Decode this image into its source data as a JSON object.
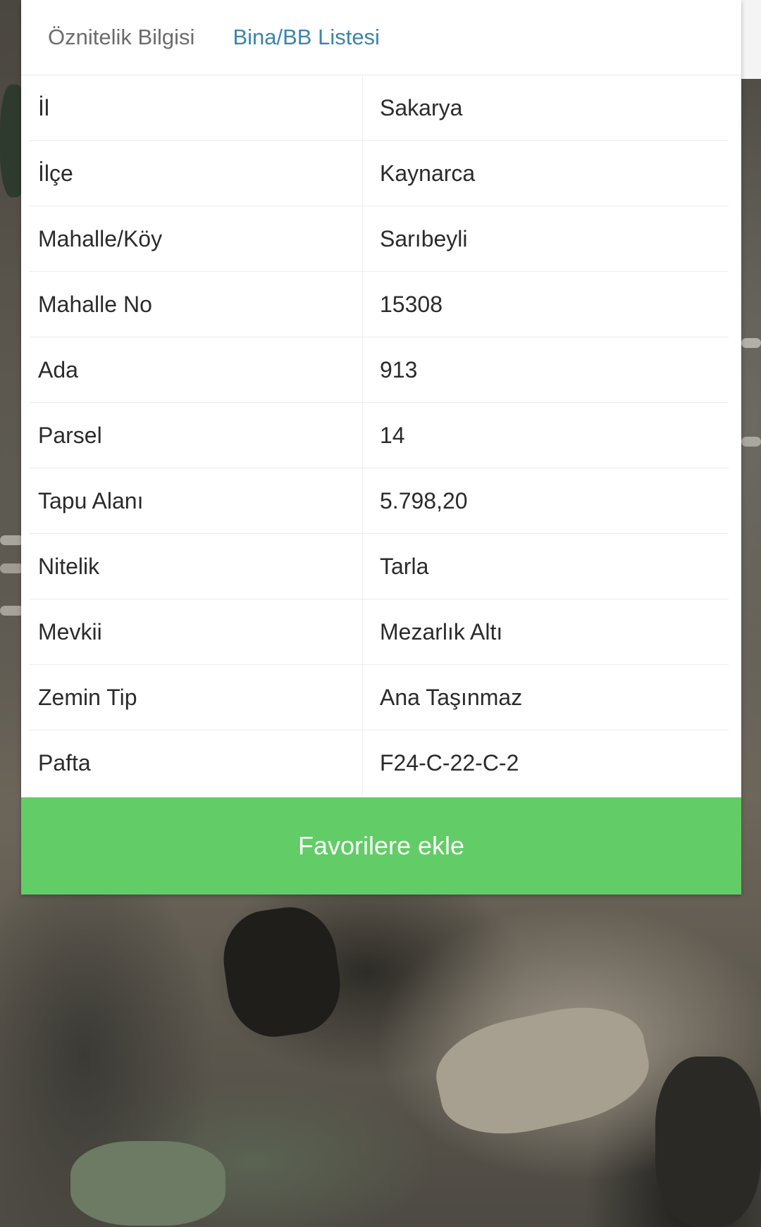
{
  "tabs": {
    "oznitelik": "Öznitelik Bilgisi",
    "bina": "Bina/BB Listesi"
  },
  "rows": [
    {
      "label": "İl",
      "value": "Sakarya"
    },
    {
      "label": "İlçe",
      "value": "Kaynarca"
    },
    {
      "label": "Mahalle/Köy",
      "value": "Sarıbeyli"
    },
    {
      "label": "Mahalle No",
      "value": "15308"
    },
    {
      "label": "Ada",
      "value": "913"
    },
    {
      "label": "Parsel",
      "value": "14"
    },
    {
      "label": "Tapu Alanı",
      "value": "5.798,20"
    },
    {
      "label": "Nitelik",
      "value": "Tarla"
    },
    {
      "label": "Mevkii",
      "value": "Mezarlık Altı"
    },
    {
      "label": "Zemin Tip",
      "value": "Ana Taşınmaz"
    },
    {
      "label": "Pafta",
      "value": "F24-C-22-C-2"
    }
  ],
  "actions": {
    "favorite_label": "Favorilere ekle"
  },
  "colors": {
    "accent_tab": "#3a86a8",
    "button_green": "#62cc66"
  }
}
